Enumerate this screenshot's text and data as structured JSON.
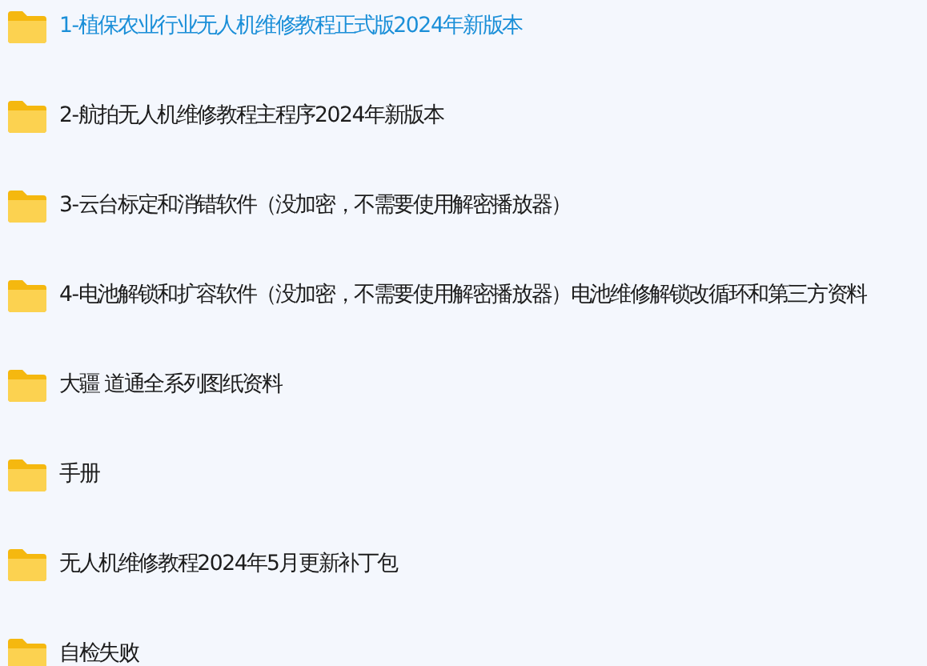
{
  "folders": [
    {
      "label": "1-植保农业行业无人机维修教程正式版2024年新版本",
      "selected": true
    },
    {
      "label": "2-航拍无人机维修教程主程序2024年新版本",
      "selected": false
    },
    {
      "label": "3-云台标定和消错软件（没加密，不需要使用解密播放器）",
      "selected": false
    },
    {
      "label": "4-电池解锁和扩容软件（没加密，不需要使用解密播放器）电池维修解锁改循环和第三方资料",
      "selected": false
    },
    {
      "label": "大疆 道通全系列图纸资料",
      "selected": false
    },
    {
      "label": "手册",
      "selected": false
    },
    {
      "label": "无人机维修教程2024年5月更新补丁包",
      "selected": false
    },
    {
      "label": "自检失败",
      "selected": false
    }
  ]
}
